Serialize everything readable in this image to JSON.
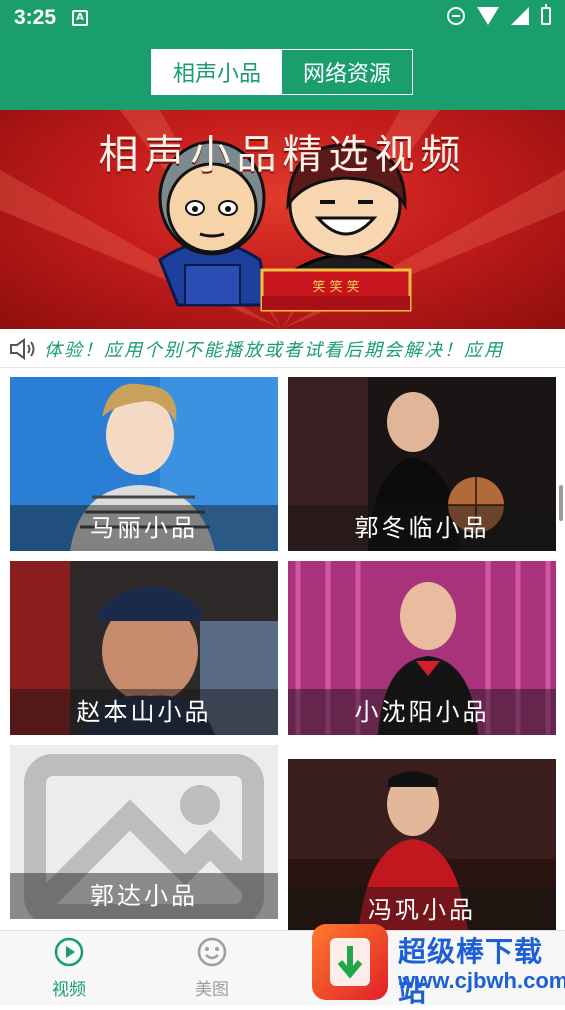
{
  "status_bar": {
    "time": "3:25",
    "notification_icon": "a-icon",
    "icons": [
      "do-not-disturb-icon",
      "wifi-icon",
      "signal-icon",
      "battery-charging-icon"
    ]
  },
  "header": {
    "tabs": [
      {
        "label": "相声小品",
        "active": true
      },
      {
        "label": "网络资源",
        "active": false
      }
    ],
    "accent_color": "#1a9e6e"
  },
  "banner": {
    "title": "相声小品精选视频",
    "sign_text": "笑 笑 笑"
  },
  "marquee": {
    "icon": "speaker-icon",
    "text": "体验！应用个别不能播放或者试看后期会解决！应用"
  },
  "grid": {
    "items": [
      {
        "caption": "马丽小品"
      },
      {
        "caption": "郭冬临小品"
      },
      {
        "caption": "赵本山小品"
      },
      {
        "caption": "小沈阳小品"
      },
      {
        "caption": "郭达小品"
      },
      {
        "caption": "冯巩小品"
      }
    ]
  },
  "bottom_nav": {
    "items": [
      {
        "label": "视频",
        "icon": "play-circle-icon",
        "active": true
      },
      {
        "label": "美图",
        "icon": "smiley-face-icon",
        "active": false
      }
    ]
  },
  "watermark": {
    "name": "超级棒下载站",
    "url": "www.cjbwh.com"
  }
}
